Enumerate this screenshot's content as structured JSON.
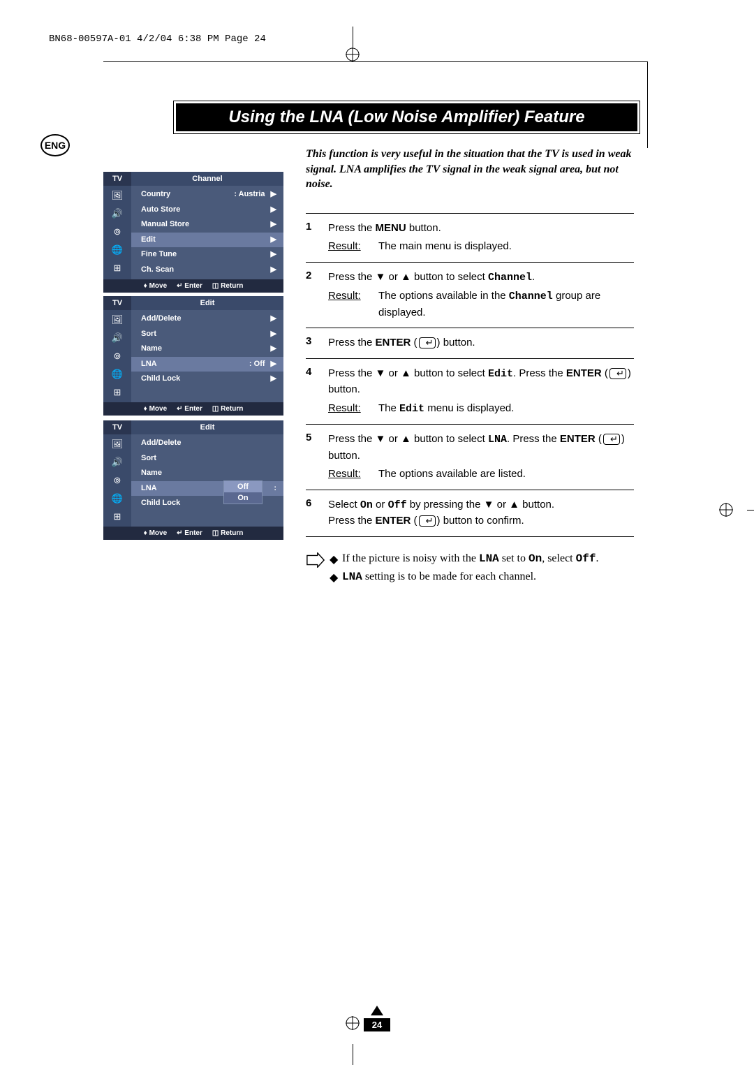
{
  "doc_header": "BN68-00597A-01  4/2/04  6:38 PM  Page 24",
  "title": "Using the LNA (Low Noise Amplifier) Feature",
  "lang_badge": "ENG",
  "intro": "This function is very useful in the situation that the TV is used in weak signal. LNA amplifies the TV signal in the weak signal area, but not noise.",
  "steps": [
    {
      "num": "1",
      "lines": [
        {
          "type": "plain",
          "pre": "Press the ",
          "bold": "MENU",
          "post": " button."
        },
        {
          "type": "result",
          "text": "The main menu is displayed."
        }
      ]
    },
    {
      "num": "2",
      "lines": [
        {
          "type": "plain",
          "pre": "Press the ▼ or ▲ button to select ",
          "mono": "Channel",
          "post": "."
        },
        {
          "type": "result",
          "text_pre": "The options available in the ",
          "mono": "Channel",
          "text_post": " group are displayed."
        }
      ]
    },
    {
      "num": "3",
      "lines": [
        {
          "type": "enter",
          "pre": "Press the ",
          "bold": "ENTER",
          "post": " button."
        }
      ]
    },
    {
      "num": "4",
      "lines": [
        {
          "type": "enter2",
          "pre": "Press the ▼ or ▲ button to select ",
          "mono": "Edit",
          "mid": ". Press the ",
          "bold": "ENTER",
          "post": " button."
        },
        {
          "type": "result",
          "text_pre": "The ",
          "mono": "Edit",
          "text_post": " menu is displayed."
        }
      ]
    },
    {
      "num": "5",
      "lines": [
        {
          "type": "enter2",
          "pre": "Press the ▼ or ▲ button to select ",
          "mono": "LNA",
          "mid": ". Press the ",
          "bold": "ENTER",
          "post": " button."
        },
        {
          "type": "result",
          "text": "The options available are listed."
        }
      ]
    },
    {
      "num": "6",
      "lines": [
        {
          "type": "onoff",
          "pre": "Select ",
          "mono1": "On",
          "mid1": " or ",
          "mono2": "Off",
          "mid2": " by pressing the ▼ or ▲ button."
        },
        {
          "type": "enter",
          "pre": "Press the ",
          "bold": "ENTER",
          "post": " button to confirm."
        }
      ]
    }
  ],
  "result_label": "Result:",
  "notes": [
    {
      "pre": "If the picture is noisy with the ",
      "mono1": "LNA",
      "mid": " set to ",
      "mono2": "On",
      "mid2": ", select ",
      "mono3": "Off",
      "post": "."
    },
    {
      "mono1": "LNA",
      "post": " setting is to be made for each channel."
    }
  ],
  "osd_footer": {
    "move": "Move",
    "enter": "Enter",
    "return": "Return"
  },
  "osd1": {
    "tab_tv": "TV",
    "tab_main": "Channel",
    "rows": [
      {
        "label": "Country",
        "val": ":   Austria",
        "arrow": "▶"
      },
      {
        "label": "Auto Store",
        "arrow": "▶"
      },
      {
        "label": "Manual Store",
        "arrow": "▶"
      },
      {
        "label": "Edit",
        "arrow": "▶",
        "sel": true
      },
      {
        "label": "Fine Tune",
        "arrow": "▶"
      },
      {
        "label": "Ch. Scan",
        "arrow": "▶"
      }
    ]
  },
  "osd2": {
    "tab_tv": "TV",
    "tab_main": "Edit",
    "rows": [
      {
        "label": "Add/Delete",
        "arrow": "▶"
      },
      {
        "label": "Sort",
        "arrow": "▶"
      },
      {
        "label": "Name",
        "arrow": "▶"
      },
      {
        "label": "LNA",
        "val": ":   Off",
        "arrow": "▶",
        "sel": true
      },
      {
        "label": "Child Lock",
        "arrow": "▶"
      }
    ]
  },
  "osd3": {
    "tab_tv": "TV",
    "tab_main": "Edit",
    "rows": [
      {
        "label": "Add/Delete"
      },
      {
        "label": "Sort"
      },
      {
        "label": "Name"
      },
      {
        "label": "LNA",
        "val": ":",
        "sel": true
      },
      {
        "label": "Child Lock"
      }
    ],
    "popup": {
      "off": "Off",
      "on": "On"
    }
  },
  "page_number": "24"
}
